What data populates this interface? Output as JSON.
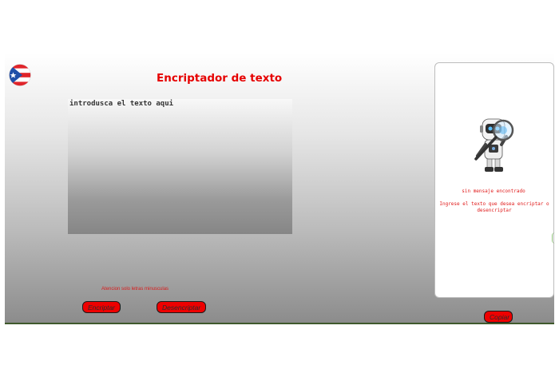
{
  "app": {
    "title": "Encriptador de texto",
    "flag_icon": "puerto-rico-flag-icon"
  },
  "editor": {
    "placeholder": "introdusca el texto aqui",
    "value": "",
    "warning": "Atencion solo letras minusculas"
  },
  "actions": {
    "encrypt_label": "Encriptar",
    "decrypt_label": "Desencriptar",
    "copy_label": "Copiar"
  },
  "output_panel": {
    "illustration": "robot-magnifier-icon",
    "empty_title": "sin mensaje encontrado",
    "empty_message": "Ingrese el texto que desea encriptar o desencriptar"
  },
  "colors": {
    "accent": "#e60000",
    "button": "#ee0000",
    "message_text": "#e01a1a"
  }
}
